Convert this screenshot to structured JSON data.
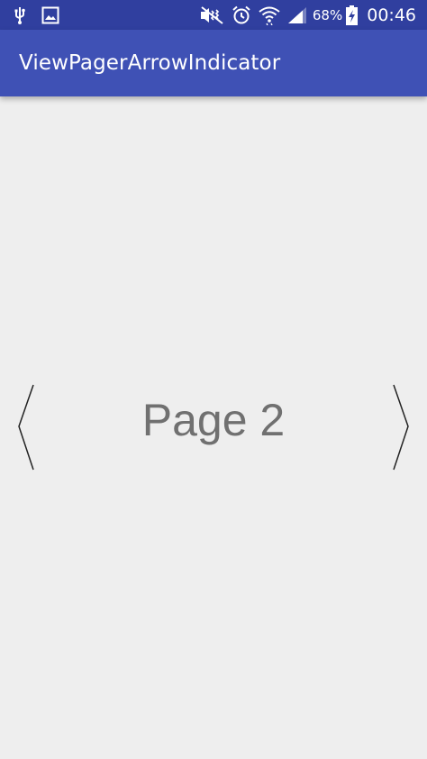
{
  "statusbar": {
    "battery_percent": "68%",
    "time": "00:46",
    "icons": [
      "usb-icon",
      "image-notification-icon",
      "mute-vibrate-icon",
      "alarm-icon",
      "wifi-icon",
      "signal-icon",
      "battery-charging-icon"
    ]
  },
  "appbar": {
    "title": "ViewPagerArrowIndicator",
    "color": "#3f51b5"
  },
  "pager": {
    "page_label": "Page 2"
  },
  "colors": {
    "statusbar": "#303f9f",
    "appbar": "#3f51b5",
    "background": "#eeeeee",
    "page_text": "#707070"
  }
}
